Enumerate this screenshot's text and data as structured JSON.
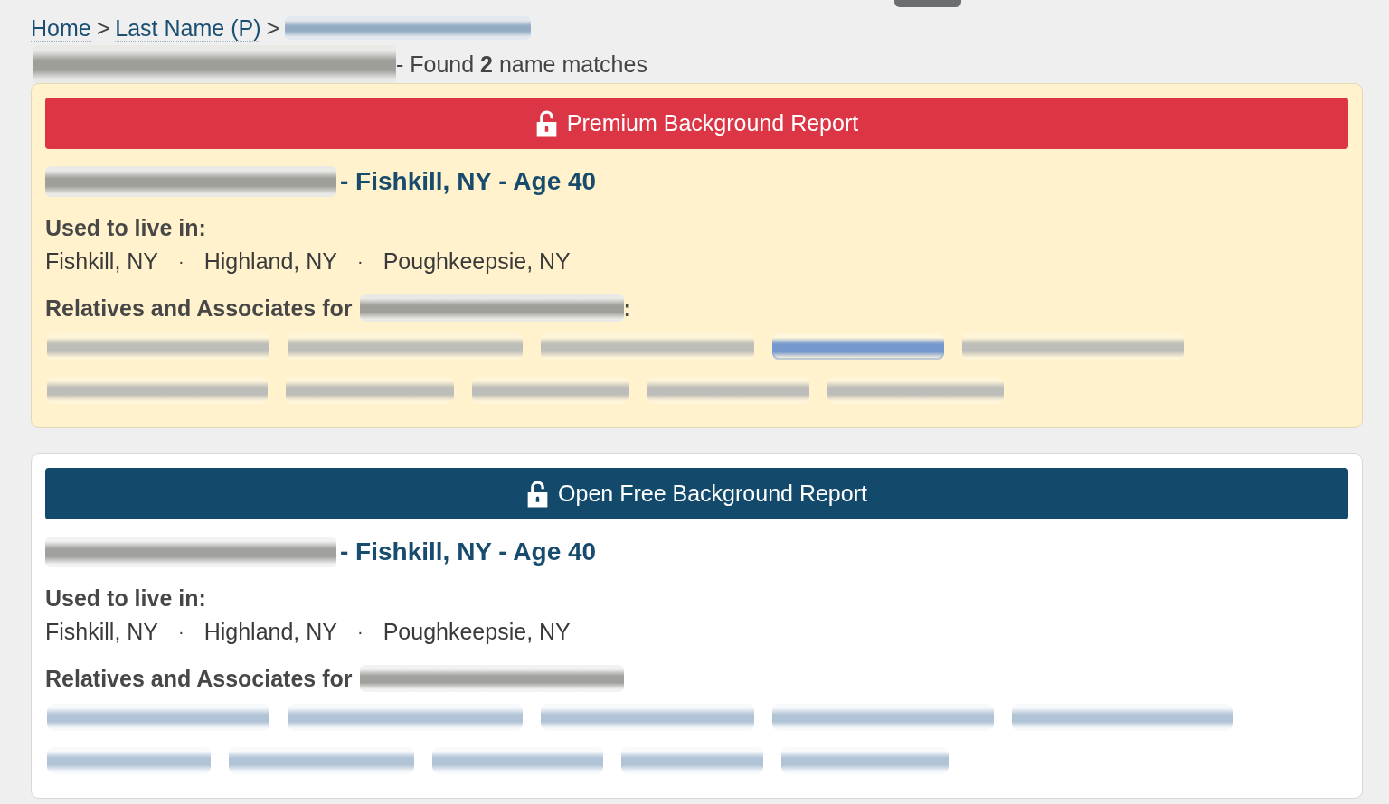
{
  "breadcrumb": [
    {
      "kind": "link",
      "label": "Home"
    },
    {
      "kind": "separator",
      "label": ">"
    },
    {
      "kind": "link",
      "label": "Last Name (P)"
    },
    {
      "kind": "separator",
      "label": ">"
    },
    {
      "kind": "blurred"
    }
  ],
  "heading": [
    {
      "kind": "blurred"
    },
    {
      "kind": "text",
      "text": "- Found **2** name matches"
    }
  ],
  "cards": [
    {
      "kind": "premium",
      "button": "Premium Background Report",
      "title": [
        {
          "kind": "blurred"
        },
        {
          "kind": "text",
          "text": "- Fishkill, NY - Age 40"
        }
      ],
      "lived_label": "Used to live in:",
      "places": [
        {
          "kind": "place",
          "text": "Fishkill, NY"
        },
        {
          "kind": "separator",
          "text": "·"
        },
        {
          "kind": "place",
          "text": "Highland, NY"
        },
        {
          "kind": "separator",
          "text": "·"
        },
        {
          "kind": "place",
          "text": "Poughkeepsie, NY"
        }
      ],
      "relatives_heading": [
        {
          "kind": "text",
          "text": "Relatives and Associates for"
        },
        {
          "kind": "blurred"
        },
        {
          "kind": "text",
          "text": ":"
        }
      ],
      "relatives": [
        {
          "linked": false
        },
        {
          "linked": false
        },
        {
          "linked": false
        },
        {
          "linked": true
        },
        {
          "linked": false
        },
        {
          "linked": false
        },
        {
          "linked": false
        },
        {
          "linked": false
        },
        {
          "linked": false
        },
        {
          "linked": false
        }
      ]
    },
    {
      "kind": "free",
      "button": "Open Free Background Report",
      "title": [
        {
          "kind": "blurred"
        },
        {
          "kind": "text",
          "text": "- Fishkill, NY - Age 40"
        }
      ],
      "lived_label": "Used to live in:",
      "places": [
        {
          "kind": "place",
          "text": "Fishkill, NY"
        },
        {
          "kind": "separator",
          "text": "·"
        },
        {
          "kind": "place",
          "text": "Highland, NY"
        },
        {
          "kind": "separator",
          "text": "·"
        },
        {
          "kind": "place",
          "text": "Poughkeepsie, NY"
        }
      ],
      "relatives_heading": [
        {
          "kind": "text",
          "text": "Relatives and Associates for"
        },
        {
          "kind": "blurred"
        }
      ],
      "relatives": [
        {
          "linked": false
        },
        {
          "linked": false
        },
        {
          "linked": false
        },
        {
          "linked": false
        },
        {
          "linked": false
        },
        {
          "linked": false
        },
        {
          "linked": false
        },
        {
          "linked": false
        },
        {
          "linked": false
        },
        {
          "linked": false
        }
      ]
    }
  ]
}
